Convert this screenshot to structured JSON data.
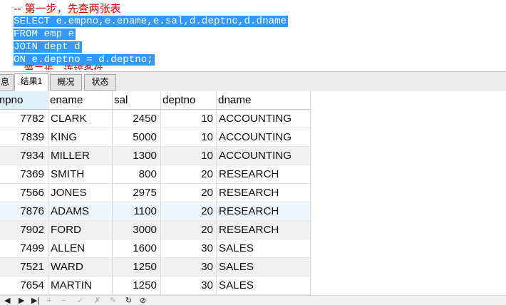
{
  "editor": {
    "comment_line": "-- 第一步，先查两张表",
    "sql_lines": [
      "SELECT e.empno,e.ename,e.sal,d.deptno,d.dname",
      "FROM emp e",
      "JOIN dept d",
      "ON e.deptno = d.deptno;"
    ],
    "partial_line": "-- 第二步，连接条件"
  },
  "tabs": [
    {
      "label": "息"
    },
    {
      "label": "结果1"
    },
    {
      "label": "概况"
    },
    {
      "label": "状态"
    }
  ],
  "grid": {
    "columns": [
      "empno",
      "ename",
      "sal",
      "deptno",
      "dname"
    ],
    "rows": [
      {
        "empno": "7782",
        "ename": "CLARK",
        "sal": "2450",
        "deptno": "10",
        "dname": "ACCOUNTING"
      },
      {
        "empno": "7839",
        "ename": "KING",
        "sal": "5000",
        "deptno": "10",
        "dname": "ACCOUNTING"
      },
      {
        "empno": "7934",
        "ename": "MILLER",
        "sal": "1300",
        "deptno": "10",
        "dname": "ACCOUNTING"
      },
      {
        "empno": "7369",
        "ename": "SMITH",
        "sal": "800",
        "deptno": "20",
        "dname": "RESEARCH"
      },
      {
        "empno": "7566",
        "ename": "JONES",
        "sal": "2975",
        "deptno": "20",
        "dname": "RESEARCH"
      },
      {
        "empno": "7876",
        "ename": "ADAMS",
        "sal": "1100",
        "deptno": "20",
        "dname": "RESEARCH"
      },
      {
        "empno": "7902",
        "ename": "FORD",
        "sal": "3000",
        "deptno": "20",
        "dname": "RESEARCH"
      },
      {
        "empno": "7499",
        "ename": "ALLEN",
        "sal": "1600",
        "deptno": "30",
        "dname": "SALES"
      },
      {
        "empno": "7521",
        "ename": "WARD",
        "sal": "1250",
        "deptno": "30",
        "dname": "SALES"
      },
      {
        "empno": "7654",
        "ename": "MARTIN",
        "sal": "1250",
        "deptno": "30",
        "dname": "SALES"
      }
    ]
  },
  "toolbar": {
    "icons": [
      "nav-first-icon",
      "nav-next-icon",
      "nav-last-icon",
      "add-record-icon",
      "delete-record-icon",
      "apply-icon",
      "cancel-icon",
      "refresh-icon",
      "stop-icon"
    ]
  },
  "colors": {
    "selection": "#3399ff",
    "comment": "#d60000",
    "header_accent": "#dff0fb"
  }
}
